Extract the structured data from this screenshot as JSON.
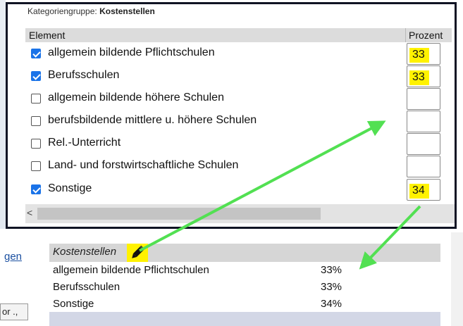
{
  "background": {
    "link_fragment": "gen",
    "text_fragment": "or .,"
  },
  "popup": {
    "group_label_prefix": "Kategoriengruppe:",
    "group_name": "Kostenstellen",
    "columns": {
      "element": "Element",
      "percent": "Prozent"
    },
    "rows": [
      {
        "label": "allgemein bildende Pflichtschulen",
        "checked": true,
        "percent": "33"
      },
      {
        "label": "Berufsschulen",
        "checked": true,
        "percent": "33"
      },
      {
        "label": "allgemein bildende höhere Schulen",
        "checked": false,
        "percent": ""
      },
      {
        "label": "berufsbildende mittlere u. höhere Schulen",
        "checked": false,
        "percent": ""
      },
      {
        "label": "Rel.-Unterricht",
        "checked": false,
        "percent": ""
      },
      {
        "label": "Land- und forstwirtschaftliche Schulen",
        "checked": false,
        "percent": ""
      },
      {
        "label": "Sonstige",
        "checked": true,
        "percent": "34"
      }
    ],
    "scroll_left_glyph": "<"
  },
  "summary": {
    "title": "Kostenstellen",
    "items": [
      {
        "label": "allgemein bildende Pflichtschulen",
        "value": "33%"
      },
      {
        "label": "Berufsschulen",
        "value": "33%"
      },
      {
        "label": "Sonstige",
        "value": "34%"
      }
    ]
  },
  "colors": {
    "highlight": "#fff200",
    "arrow": "#52e052",
    "checkbox": "#1a73e8",
    "link": "#1a4fa0"
  },
  "icons": {
    "edit": "pencil-icon"
  }
}
